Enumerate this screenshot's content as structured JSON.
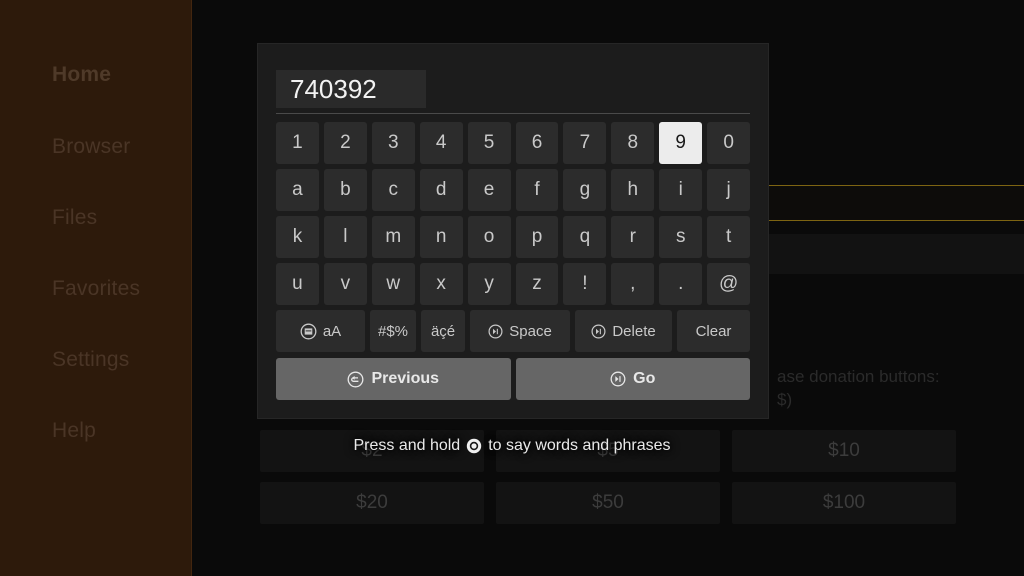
{
  "theme": {
    "app_background": "#0a0a0a",
    "sidebar_background": "#2d1a0b",
    "dialog_background": "#1c1c1c",
    "key_background": "#2c2c2c",
    "key_highlight_background": "#ececec",
    "action_button_background": "#666666",
    "focus_border": "#7d6412"
  },
  "sidebar": {
    "items": [
      {
        "label": "Home",
        "selected": true
      },
      {
        "label": "Browser",
        "selected": false
      },
      {
        "label": "Files",
        "selected": false
      },
      {
        "label": "Favorites",
        "selected": false
      },
      {
        "label": "Settings",
        "selected": false
      },
      {
        "label": "Help",
        "selected": false
      }
    ]
  },
  "background": {
    "text_line_1": "ase donation buttons:",
    "text_line_2": "$)",
    "donation_buttons": [
      "$2",
      "$5",
      "$10",
      "$20",
      "$50",
      "$100"
    ]
  },
  "keyboard": {
    "input_value": "740392",
    "highlighted_key": "9",
    "rows": [
      [
        "1",
        "2",
        "3",
        "4",
        "5",
        "6",
        "7",
        "8",
        "9",
        "0"
      ],
      [
        "a",
        "b",
        "c",
        "d",
        "e",
        "f",
        "g",
        "h",
        "i",
        "j"
      ],
      [
        "k",
        "l",
        "m",
        "n",
        "o",
        "p",
        "q",
        "r",
        "s",
        "t"
      ],
      [
        "u",
        "v",
        "w",
        "x",
        "y",
        "z",
        "!",
        ",",
        ".",
        "@"
      ]
    ],
    "function_keys": {
      "case_label": "aA",
      "case_icon": "caps-toggle-icon",
      "symbols_label": "#$%",
      "accents_label": "äçé",
      "space_label": "Space",
      "space_icon": "play-pause-icon",
      "delete_label": "Delete",
      "delete_icon": "play-pause-icon",
      "clear_label": "Clear"
    },
    "actions": {
      "previous_label": "Previous",
      "previous_icon": "back-arrow-icon",
      "go_label": "Go",
      "go_icon": "play-pause-icon"
    }
  },
  "voice_hint": {
    "text_before": "Press and hold",
    "icon": "microphone-button-icon",
    "text_after": "to say words and phrases"
  }
}
